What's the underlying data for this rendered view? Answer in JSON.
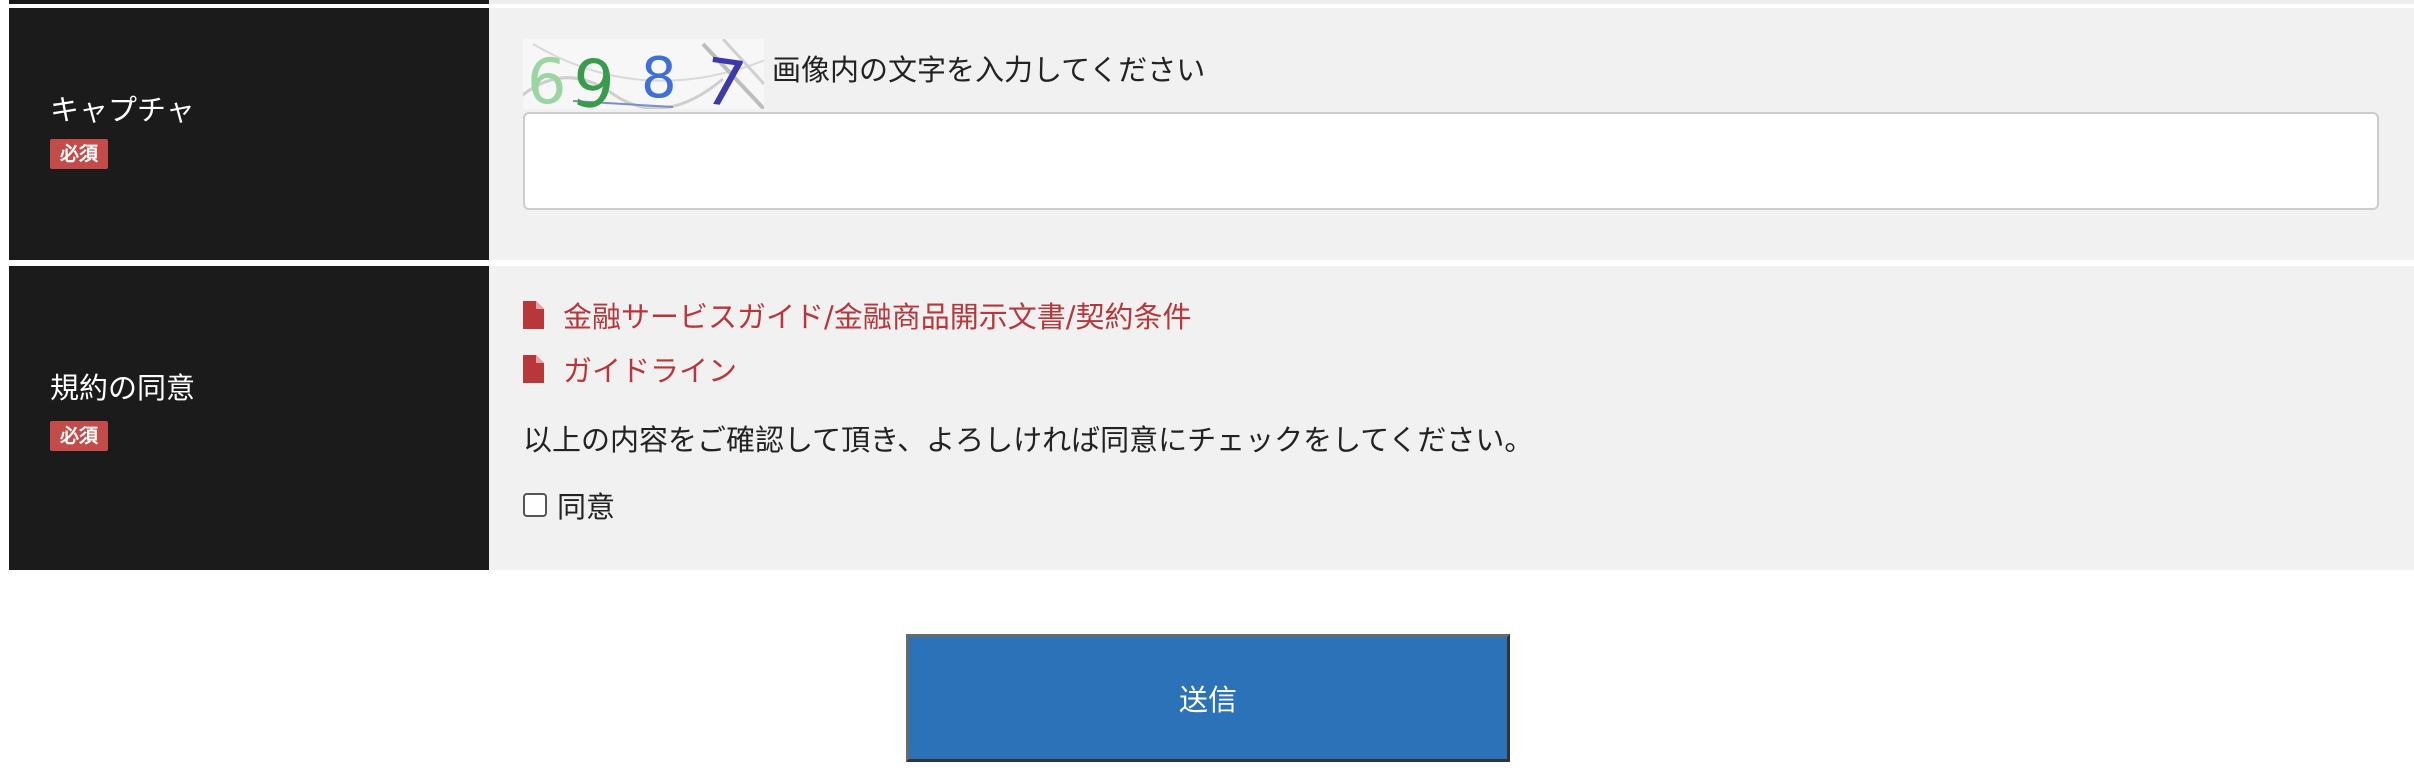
{
  "captcha_row": {
    "label": "キャプチャ",
    "required_badge": "必須",
    "captcha_code": "69 8 7",
    "instruction": "画像内の文字を入力してください",
    "input_value": ""
  },
  "agreement_row": {
    "label": "規約の同意",
    "required_badge": "必須",
    "links": [
      {
        "label": "金融サービスガイド/金融商品開示文書/契約条件",
        "icon": "file-icon"
      },
      {
        "label": "ガイドライン",
        "icon": "file-icon"
      }
    ],
    "instruction": "以上の内容をご確認して頂き、よろしければ同意にチェックをしてください。",
    "checkbox_label": "同意",
    "checkbox_checked": false
  },
  "submit": {
    "label": "送信"
  },
  "colors": {
    "label_bg": "#1b1b1b",
    "value_bg": "#f1f1f1",
    "badge": "#c34c4a",
    "link": "#b8373a",
    "button": "#2b72b9"
  }
}
